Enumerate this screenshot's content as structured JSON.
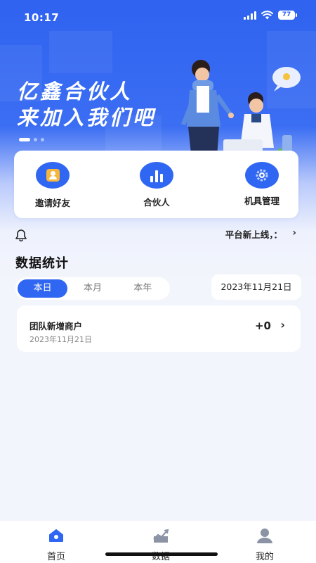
{
  "status_bar": {
    "time": "10:17",
    "battery": "77"
  },
  "banner": {
    "title_line1": "亿鑫合伙人",
    "title_line2": "来加入我们吧",
    "slide_count": 3,
    "active_slide": 1
  },
  "quick_menu": {
    "items": [
      {
        "label": "邀请好友",
        "icon": "invite-friends-icon"
      },
      {
        "label": "合伙人",
        "icon": "bar-chart-icon"
      },
      {
        "label": "机具管理",
        "icon": "gear-icon"
      }
    ]
  },
  "notice": {
    "text": "平台新上线，：",
    "icon": "bell-icon"
  },
  "stats": {
    "title": "数据统计",
    "tabs": [
      "本日",
      "本月",
      "本年"
    ],
    "active_tab": "本日",
    "date": "2023年11月21日",
    "card": {
      "name": "团队新增商户",
      "date": "2023年11月21日",
      "value": "+0"
    }
  },
  "tabbar": {
    "items": [
      {
        "label": "首页",
        "icon": "home-icon"
      },
      {
        "label": "数据",
        "icon": "chart-trend-icon"
      },
      {
        "label": "我的",
        "icon": "user-icon"
      }
    ]
  },
  "colors": {
    "primary": "#3067f2",
    "banner": "#2f63f0",
    "background": "#f3f5fc"
  }
}
